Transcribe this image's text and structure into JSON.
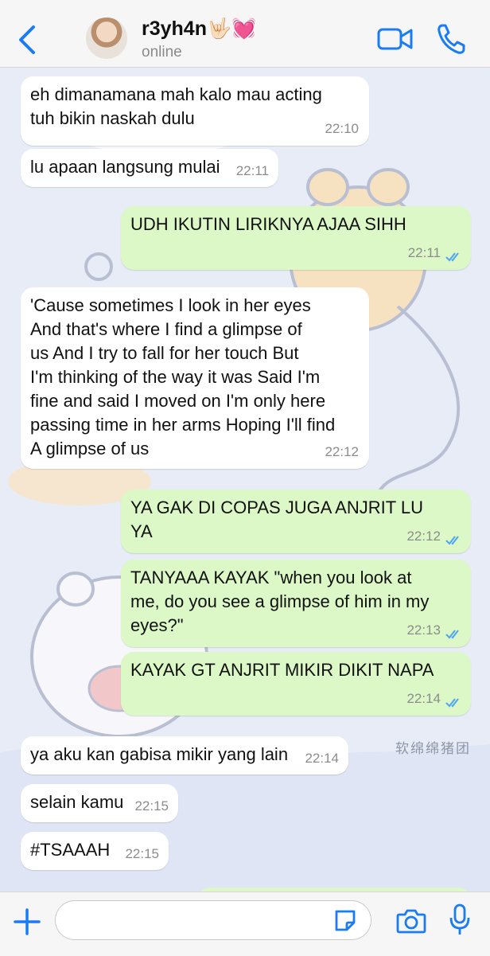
{
  "contact": {
    "name": "r3yh4n🤟🏻💓",
    "status": "online"
  },
  "chat": {
    "watermark": "软绵绵猪团",
    "messages": [
      {
        "direction": "in",
        "text": "eh dimanamana mah kalo mau acting\ntuh bikin naskah dulu",
        "time": "22:10"
      },
      {
        "direction": "in",
        "text": "lu apaan langsung mulai",
        "time": "22:11"
      },
      {
        "direction": "out",
        "text": "UDH IKUTIN LIRIKNYA AJAA SIHH",
        "time": "22:11",
        "read": true
      },
      {
        "direction": "in",
        "text": "'Cause sometimes I look in her eyes\nAnd that's where I find a glimpse of\nus And I try to fall for her touch But\nI'm thinking of the way it was Said I'm\nfine and said I moved on I'm only here\npassing time in her arms Hoping I'll find\nA glimpse of us",
        "time": "22:12"
      },
      {
        "direction": "out",
        "text": "YA GAK DI COPAS JUGA ANJRIT LU\nYA",
        "time": "22:12",
        "read": true
      },
      {
        "direction": "out",
        "text": "TANYAAA KAYAK \"when you look at\nme, do you see a glimpse of him in my\neyes?\"",
        "time": "22:13",
        "read": true
      },
      {
        "direction": "out",
        "text": "KAYAK GT ANJRIT MIKIR DIKIT NAPA",
        "time": "22:14",
        "read": true
      },
      {
        "direction": "in",
        "text": "ya aku kan gabisa mikir yang lain",
        "time": "22:14"
      },
      {
        "direction": "in",
        "text": "selain kamu",
        "time": "22:15"
      },
      {
        "direction": "in",
        "text": "#TSAAAH",
        "time": "22:15"
      }
    ]
  },
  "composer": {
    "input_value": "",
    "placeholder": ""
  },
  "icons": {
    "back": "chevron-left-icon",
    "video": "video-camera-icon",
    "call": "phone-icon",
    "attach": "plus-icon",
    "sticker": "sticker-icon",
    "camera": "camera-icon",
    "mic": "microphone-icon",
    "read_receipt": "double-check-icon"
  },
  "colors": {
    "accent": "#1a7cf5",
    "outgoing_bubble": "#dcf8c6",
    "incoming_bubble": "#ffffff",
    "read_ticks": "#4fa3f7"
  }
}
